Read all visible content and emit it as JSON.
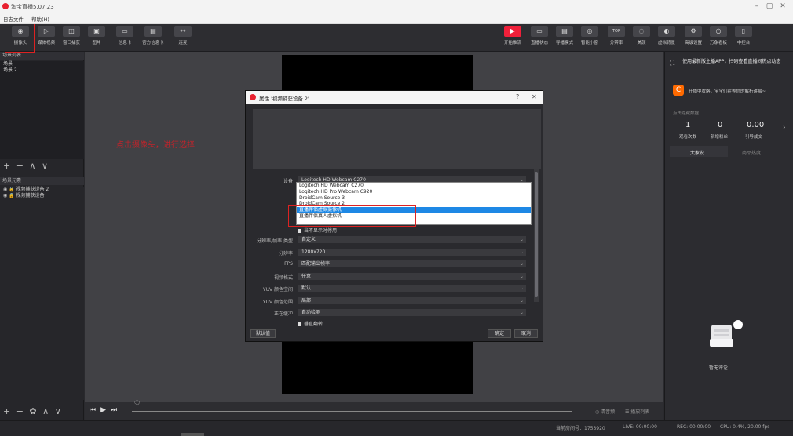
{
  "app": {
    "title": "淘宝直播5.07.23",
    "menu": [
      "日志文件",
      "帮助(H)"
    ]
  },
  "window_controls": [
    "–",
    "▢",
    "✕"
  ],
  "toolbar": {
    "left": [
      {
        "label": "摄像头",
        "icon": "camera-icon",
        "glyph": "◉"
      },
      {
        "label": "媒体视频",
        "icon": "play-icon",
        "glyph": "▷"
      },
      {
        "label": "窗口捕获",
        "icon": "window-icon",
        "glyph": "◫"
      },
      {
        "label": "图片",
        "icon": "image-icon",
        "glyph": "▣"
      },
      {
        "label": "信息卡",
        "icon": "card-icon",
        "glyph": "▭"
      },
      {
        "label": "官方信息卡",
        "icon": "official-card-icon",
        "glyph": "▤"
      },
      {
        "label": "连麦",
        "icon": "link-mic-icon",
        "glyph": "⚯"
      }
    ],
    "right": [
      {
        "label": "开始推流",
        "icon": "start-stream-icon",
        "glyph": "▶",
        "red": true
      },
      {
        "label": "直播状态",
        "icon": "status-icon",
        "glyph": "▭"
      },
      {
        "label": "导播模式",
        "icon": "director-icon",
        "glyph": "▤"
      },
      {
        "label": "智能小窗",
        "icon": "smart-window-icon",
        "glyph": "◎"
      },
      {
        "label": "分辨率",
        "icon": "resolution-icon",
        "glyph": "TOP"
      },
      {
        "label": "美颜",
        "icon": "beauty-icon",
        "glyph": "◌"
      },
      {
        "label": "虚拟背景",
        "icon": "virtual-bg-icon",
        "glyph": "◐"
      },
      {
        "label": "高级设置",
        "icon": "settings-icon",
        "glyph": "⚙"
      },
      {
        "label": "万象看板",
        "icon": "dashboard-icon",
        "glyph": "◷"
      },
      {
        "label": "中控台",
        "icon": "console-icon",
        "glyph": "▯"
      }
    ]
  },
  "scenes": {
    "header": "场景列表",
    "items": [
      "场景",
      "场景 2"
    ],
    "controls": "+ − ∧ ∨"
  },
  "sources": {
    "header": "场景元素",
    "items": [
      "◉ 🔒 视频捕获设备 2",
      "◉ 🔒 视频捕获设备"
    ],
    "controls": "+ − ✿ ∧ ∨"
  },
  "annotation": "点击摄像头，进行选择",
  "dialog": {
    "title": "属性 '视频捕获设备 2'",
    "help": "?",
    "close": "✕",
    "device_label": "设备",
    "device_value": "Logitech HD Webcam C270",
    "dropdown_options": [
      "Logitech HD Webcam C270",
      "Logitech HD Pro Webcam C920",
      "DroidCam Source 3",
      "DroidCam Source 2",
      "直播伴侣虚拟摄像机",
      "直播伴侣真人虚拟机"
    ],
    "dropdown_selected_index": 4,
    "checkbox_inactive": "当不显示时停用",
    "rows": [
      {
        "label": "分辨率/帧率 类型",
        "value": "自定义"
      },
      {
        "label": "分辨率",
        "value": "1280x720"
      },
      {
        "label": "FPS",
        "value": "匹配输出帧率"
      },
      {
        "label": "视频格式",
        "value": "任意"
      },
      {
        "label": "YUV 颜色空间",
        "value": "默认"
      },
      {
        "label": "YUV 颜色范围",
        "value": "局部"
      },
      {
        "label": "正在缓冲",
        "value": "自动检测"
      }
    ],
    "checkbox_flip": "垂直翻转",
    "defaults_button": "默认值",
    "ok_button": "确定",
    "cancel_button": "取消"
  },
  "right_panel": {
    "banner": "使用最新版主播APP，扫码查看直播间热点动态",
    "promo": "开播中攻略，宝宝们在等你的解析讲解~",
    "hidden_data": "点击隐藏数据",
    "stats": [
      {
        "value": "1",
        "label": "观看次数"
      },
      {
        "value": "0",
        "label": "新增粉丝"
      },
      {
        "value": "0.00",
        "label": "引导成交"
      }
    ],
    "tabs": [
      "大家说",
      "商品热度"
    ],
    "empty_comment": "暂无评论"
  },
  "transport": {
    "scene_btn": "◎ 清音频",
    "list_btn": "☰ 播放列表"
  },
  "status": {
    "viewers": "当前房间号：1753920",
    "live": "LIVE: 00:00:00",
    "rec": "REC: 00:00:00",
    "cpu": "CPU: 0.4%, 20.00 fps"
  }
}
